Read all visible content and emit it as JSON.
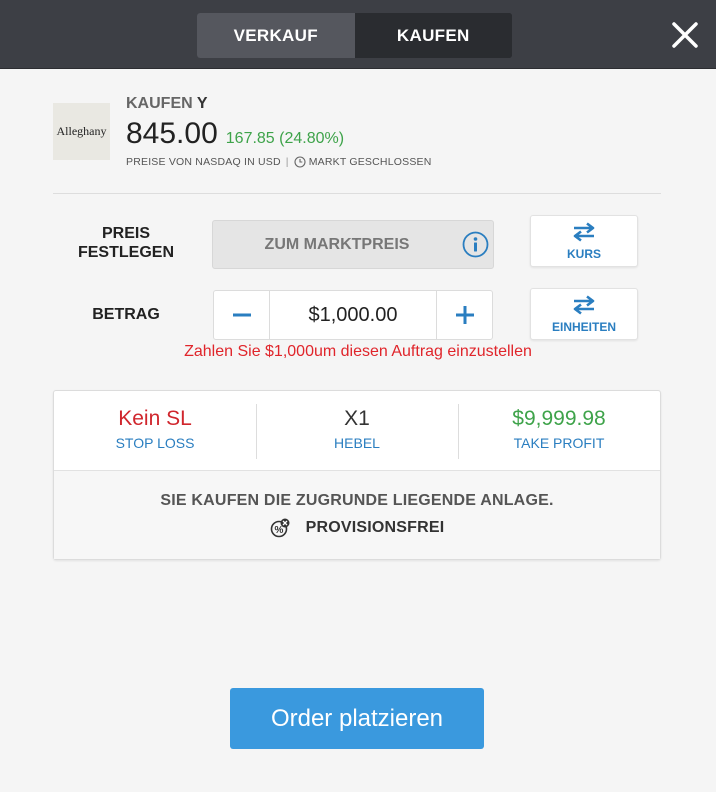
{
  "tabs": {
    "sell_label": "VERKAUF",
    "buy_label": "KAUFEN",
    "active": "sell"
  },
  "instrument": {
    "logo_text": "Alleghany",
    "action": "KAUFEN",
    "symbol": "Y",
    "price": "845.00",
    "change": "167.85 (24.80%)",
    "source": "PREISE VON NASDAQ IN USD",
    "market_status": "MARKT GESCHLOSSEN"
  },
  "price_row": {
    "label_line1": "PREIS",
    "label_line2": "FESTLEGEN",
    "market_price": "ZUM MARKTPREIS",
    "toggle_label": "KURS"
  },
  "amount_row": {
    "label": "BETRAG",
    "value": "$1,000.00",
    "toggle_label": "EINHEITEN",
    "error": "Zahlen Sie $1,000um diesen Auftrag einzustellen"
  },
  "metrics": [
    {
      "value": "Kein SL",
      "label": "STOP LOSS",
      "color": "#d0262d"
    },
    {
      "value": "X1",
      "label": "HEBEL",
      "color": "#333333"
    },
    {
      "value": "$9,999.98",
      "label": "TAKE PROFIT",
      "color": "#3ea34a"
    }
  ],
  "info": {
    "line1": "SIE KAUFEN DIE ZUGRUNDE LIEGENDE ANLAGE.",
    "line2": "PROVISIONSFREI"
  },
  "order_button": "Order platzieren",
  "colors": {
    "accent": "#3a99de",
    "link": "#2a7ec0",
    "positive": "#3ea34a",
    "negative": "#e0252b",
    "topbar": "#3d3f45"
  },
  "icons": [
    "close-icon",
    "clock-icon",
    "info-icon",
    "swap-icon",
    "minus-icon",
    "plus-icon",
    "commission-free-icon"
  ]
}
